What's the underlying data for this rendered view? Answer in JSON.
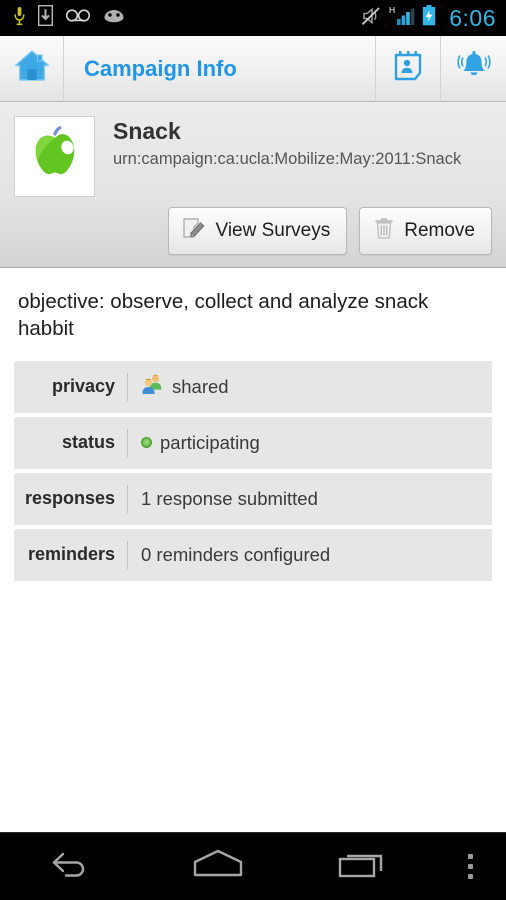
{
  "statusbar": {
    "time": "6:06",
    "left_icons": [
      "microphone-icon",
      "download-icon",
      "voicemail-icon",
      "android-head-icon"
    ],
    "right_icons": [
      "silent-mode-icon",
      "signal-h-icon",
      "battery-charging-icon"
    ],
    "signal_label": "H",
    "time_color": "#33b5e5"
  },
  "actionbar": {
    "home_icon": "home-icon",
    "title": "Campaign Info",
    "title_color": "#2196e8",
    "buttons": [
      {
        "name": "profile-card-icon",
        "label": ""
      },
      {
        "name": "bell-icon",
        "label": ""
      }
    ]
  },
  "campaign": {
    "icon": "green-apple-icon",
    "name": "Snack",
    "urn": "urn:campaign:ca:ucla:Mobilize:May:2011:Snack",
    "buttons": [
      {
        "label": "View Surveys",
        "icon": "pencil-edit-icon"
      },
      {
        "label": "Remove",
        "icon": "trash-icon"
      }
    ],
    "description": "objective: observe, collect and analyze snack habbit",
    "info_rows": [
      {
        "label": "privacy",
        "value": "shared",
        "icon": "two-people-icon"
      },
      {
        "label": "status",
        "value": "participating",
        "icon": "green-status-dot"
      },
      {
        "label": "responses",
        "value": "1 response submitted",
        "icon": ""
      },
      {
        "label": "reminders",
        "value": "0 reminders configured",
        "icon": ""
      }
    ]
  },
  "navbar": {
    "back": "back-icon",
    "home": "home-icon",
    "recents": "recents-icon",
    "overflow": "overflow-menu-icon"
  }
}
